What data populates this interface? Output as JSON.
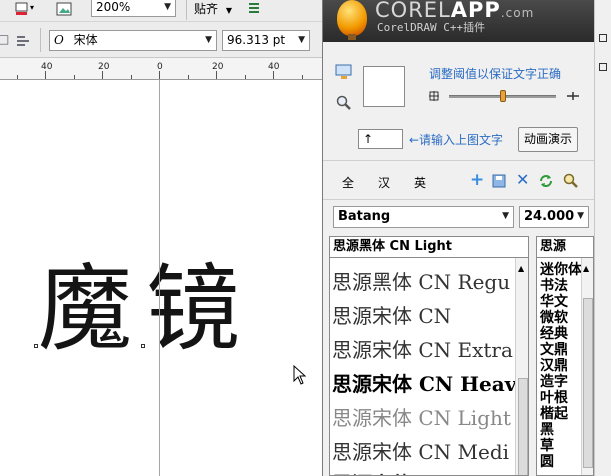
{
  "toolbar": {
    "zoom_value": "200%",
    "snap_label": "贴齐",
    "font_name": "宋体",
    "font_size": "96.313 pt"
  },
  "ruler": {
    "labels": [
      "40",
      "20",
      "0",
      "20",
      "40"
    ]
  },
  "canvas": {
    "char1": "魔",
    "char2": "镜"
  },
  "plugin": {
    "banner_title_main": "COREL",
    "banner_title_app": "APP",
    "banner_title_suffix": ".com",
    "banner_subtitle": "CorelDRAW C++插件",
    "threshold_label": "调整阈值以保证文字正确",
    "text_input_value": "↑",
    "input_hint": "←请输入上图文字",
    "demo_button": "动画演示",
    "filter_tabs": [
      "全",
      "汉",
      "英"
    ],
    "font_select": "Batang",
    "size_select": "24.000",
    "list_header": "思源黑体 CN Light",
    "font_list": [
      "思源黑体 CN Regu",
      "思源宋体 CN",
      "思源宋体 CN Extra",
      "思源宋体 CN Heav",
      "思源宋体 CN Light",
      "思源宋体 CN Medi",
      "思源宋体 CN"
    ],
    "vertical_header": "思源",
    "vertical_col1": "迷书华微经文汉造叶楷黑草圆",
    "vertical_col2": "你法文软典鼎鼎字根起",
    "vertical_col3": "体"
  }
}
